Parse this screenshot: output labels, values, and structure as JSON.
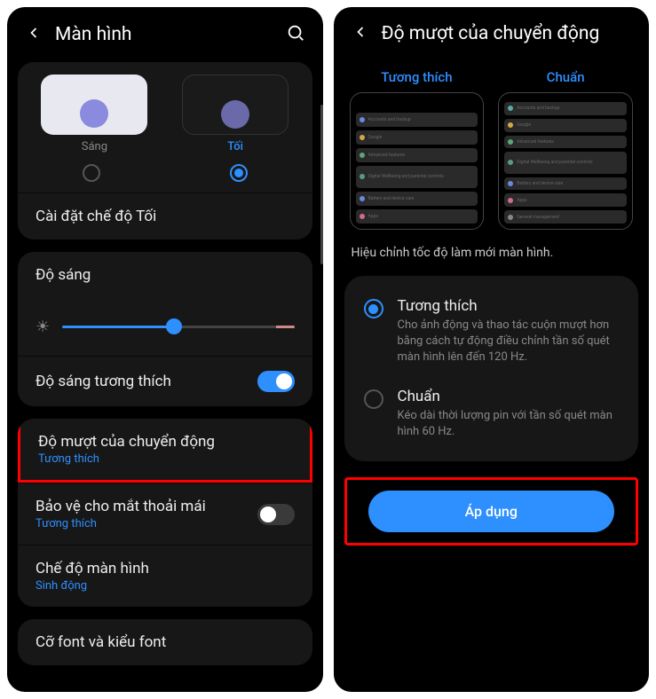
{
  "left": {
    "title": "Màn hình",
    "theme_light": "Sáng",
    "theme_dark": "Tối",
    "dark_settings": "Cài đặt chế độ Tối",
    "brightness": "Độ sáng",
    "adaptive_brightness": "Độ sáng tương thích",
    "motion_smoothness": "Độ mượt của chuyển động",
    "motion_sub": "Tương thích",
    "eye_comfort": "Bảo vệ cho mắt thoải mái",
    "eye_sub": "Tương thích",
    "screen_mode": "Chế độ màn hình",
    "screen_mode_sub": "Sinh động",
    "font": "Cỡ font và kiểu font"
  },
  "right": {
    "title": "Độ mượt của chuyển động",
    "tab_adaptive": "Tương thích",
    "tab_standard": "Chuẩn",
    "desc": "Hiệu chỉnh tốc độ làm mới màn hình.",
    "opt1_title": "Tương thích",
    "opt1_desc": "Cho ảnh động và thao tác cuộn mượt hơn bằng cách tự động điều chỉnh tần số quét màn hình lên đến 120 Hz.",
    "opt2_title": "Chuẩn",
    "opt2_desc": "Kéo dài thời lượng pin với tần số quét màn hình 60 Hz.",
    "apply": "Áp dụng"
  }
}
